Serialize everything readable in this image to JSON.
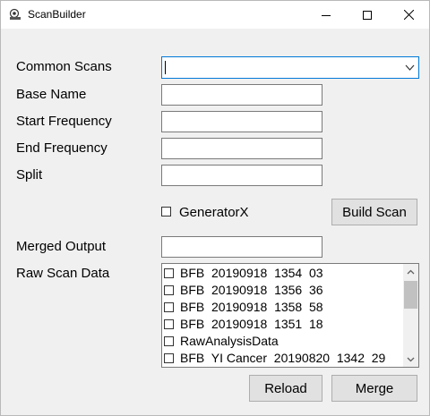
{
  "window": {
    "title": "ScanBuilder",
    "controls": {
      "minimize": "minimize-icon",
      "maximize": "maximize-icon",
      "close": "close-icon"
    }
  },
  "form": {
    "common_scans": {
      "label": "Common Scans",
      "value": ""
    },
    "base_name": {
      "label": "Base Name",
      "value": ""
    },
    "start_frequency": {
      "label": "Start Frequency",
      "value": ""
    },
    "end_frequency": {
      "label": "End Frequency",
      "value": ""
    },
    "split": {
      "label": "Split",
      "value": ""
    },
    "generator_checkbox": {
      "label": "GeneratorX",
      "checked": false
    },
    "build_scan_label": "Build Scan",
    "merged_output": {
      "label": "Merged Output",
      "value": ""
    },
    "raw_scan_data": {
      "label": "Raw Scan Data",
      "items": [
        "BFB  20190918  1354  03",
        "BFB  20190918  1356  36",
        "BFB  20190918  1358  58",
        "BFB  20190918  1351  18",
        "RawAnalysisData",
        "BFB  YI Cancer  20190820  1342  29"
      ]
    }
  },
  "buttons": {
    "reload": "Reload",
    "merge": "Merge"
  }
}
